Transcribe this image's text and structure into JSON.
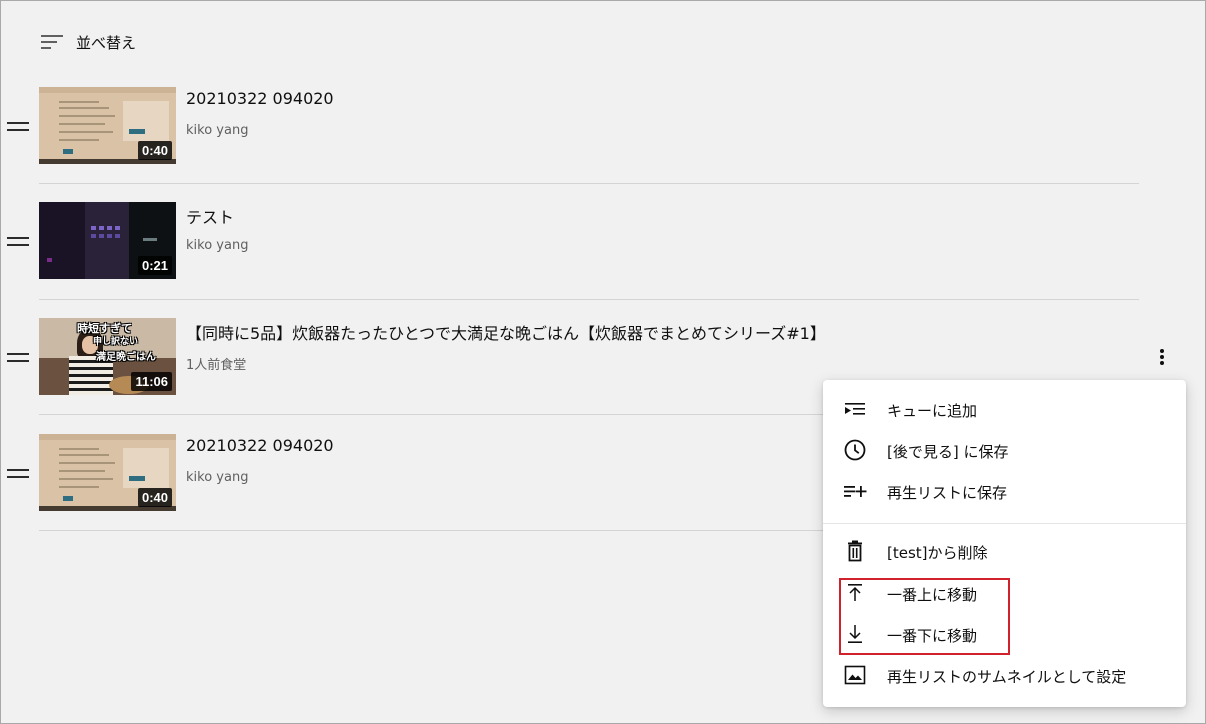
{
  "sort": {
    "label": "並べ替え"
  },
  "videos": [
    {
      "title": "20210322 094020",
      "channel": "kiko yang",
      "duration": "0:40"
    },
    {
      "title": "テスト",
      "channel": "kiko yang",
      "duration": "0:21"
    },
    {
      "title": "【同時に5品】炊飯器たったひとつで大満足な晩ごはん【炊飯器でまとめてシリーズ#1】",
      "channel": "1人前食堂",
      "duration": "11:06",
      "thumb_text": [
        "時短すぎて",
        "申し訳ない",
        "満足晩ごはん"
      ]
    },
    {
      "title": "20210322 094020",
      "channel": "kiko yang",
      "duration": "0:40"
    }
  ],
  "menu": {
    "items": [
      {
        "label": "キューに追加",
        "icon": "add-to-queue-icon"
      },
      {
        "label": "[後で見る] に保存",
        "icon": "clock-icon"
      },
      {
        "label": "再生リストに保存",
        "icon": "playlist-add-icon"
      },
      {
        "label": "[test]から削除",
        "icon": "trash-icon"
      },
      {
        "label": "一番上に移動",
        "icon": "arrow-to-top-icon"
      },
      {
        "label": "一番下に移動",
        "icon": "arrow-to-bottom-icon"
      },
      {
        "label": "再生リストのサムネイルとして設定",
        "icon": "image-icon"
      }
    ]
  },
  "colors": {
    "background": "#f1f1f1",
    "highlight_box": "#d0212c",
    "text_secondary": "#606060"
  }
}
